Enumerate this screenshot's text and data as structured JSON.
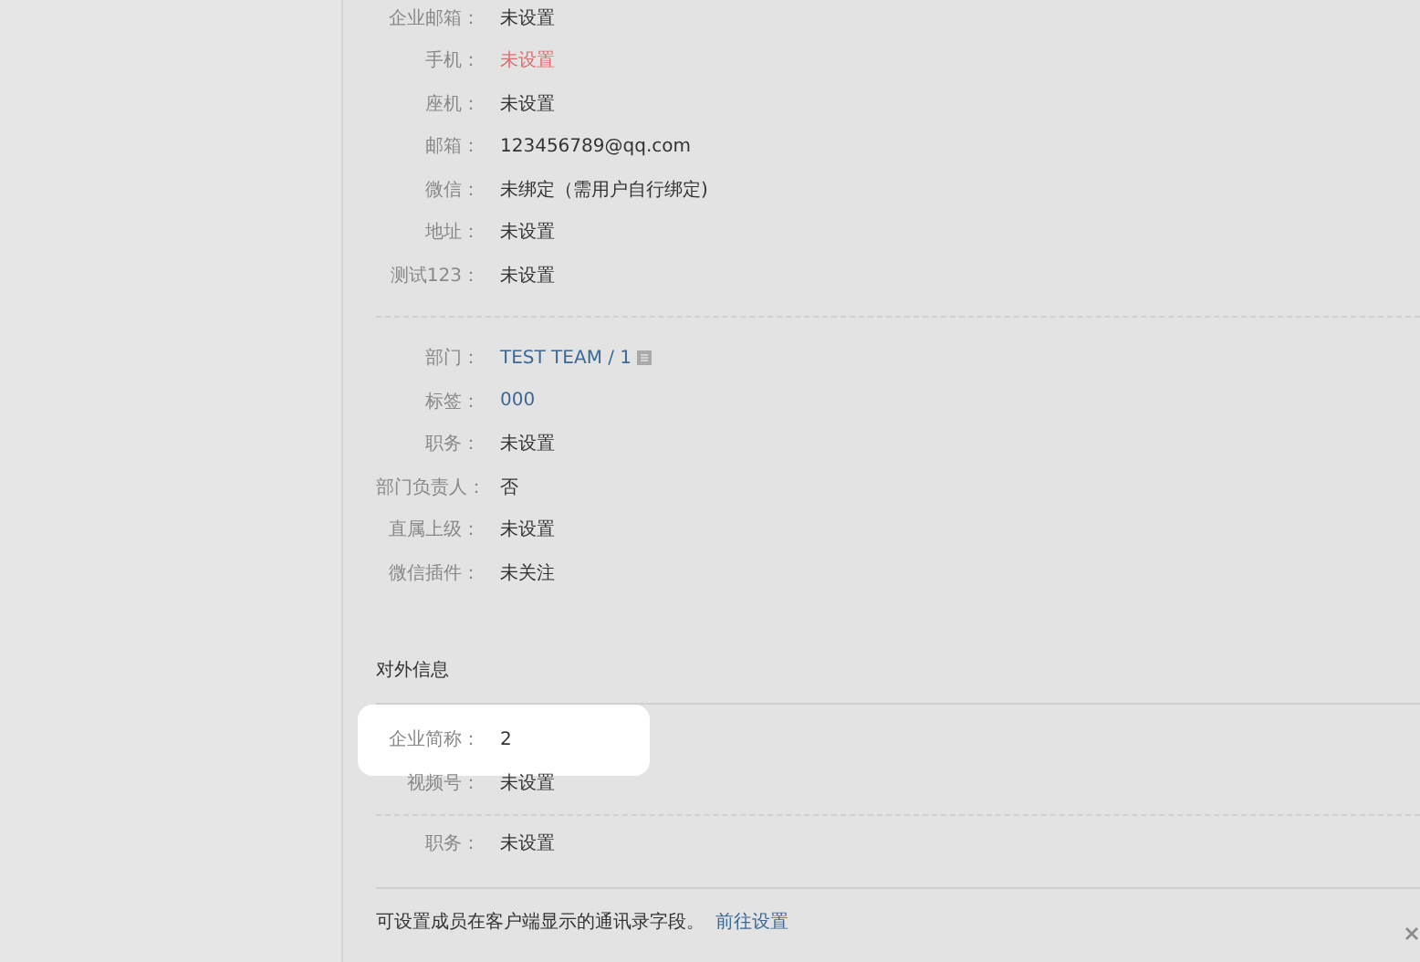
{
  "contact_fields": [
    {
      "label": "企业邮箱：",
      "value": "未设置",
      "kind": "plain"
    },
    {
      "label": "手机：",
      "value": "未设置",
      "kind": "warning"
    },
    {
      "label": "座机：",
      "value": "未设置",
      "kind": "plain"
    },
    {
      "label": "邮箱：",
      "value": "123456789@qq.com",
      "kind": "plain"
    },
    {
      "label": "微信：",
      "value": "未绑定（需用户自行绑定)",
      "kind": "plain"
    },
    {
      "label": "地址：",
      "value": "未设置",
      "kind": "plain"
    },
    {
      "label": "测试123：",
      "value": "未设置",
      "kind": "plain"
    }
  ],
  "org_fields": [
    {
      "label": "部门：",
      "value": "TEST TEAM / 1",
      "kind": "department"
    },
    {
      "label": "标签：",
      "value": "000",
      "kind": "link"
    },
    {
      "label": "职务：",
      "value": "未设置",
      "kind": "plain"
    },
    {
      "label": "部门负责人：",
      "value": "否",
      "kind": "plain"
    },
    {
      "label": "直属上级：",
      "value": "未设置",
      "kind": "plain"
    },
    {
      "label": "微信插件：",
      "value": "未关注",
      "kind": "plain"
    }
  ],
  "external_section": {
    "title": "对外信息",
    "fields": [
      {
        "label": "企业简称：",
        "value": "2",
        "highlighted": true
      },
      {
        "label": "视频号：",
        "value": "未设置",
        "highlighted": false
      }
    ],
    "extra_fields": [
      {
        "label": "职务：",
        "value": "未设置",
        "highlighted": false
      }
    ]
  },
  "footer": {
    "note": "可设置成员在客户端显示的通讯录字段。",
    "link": "前往设置"
  }
}
